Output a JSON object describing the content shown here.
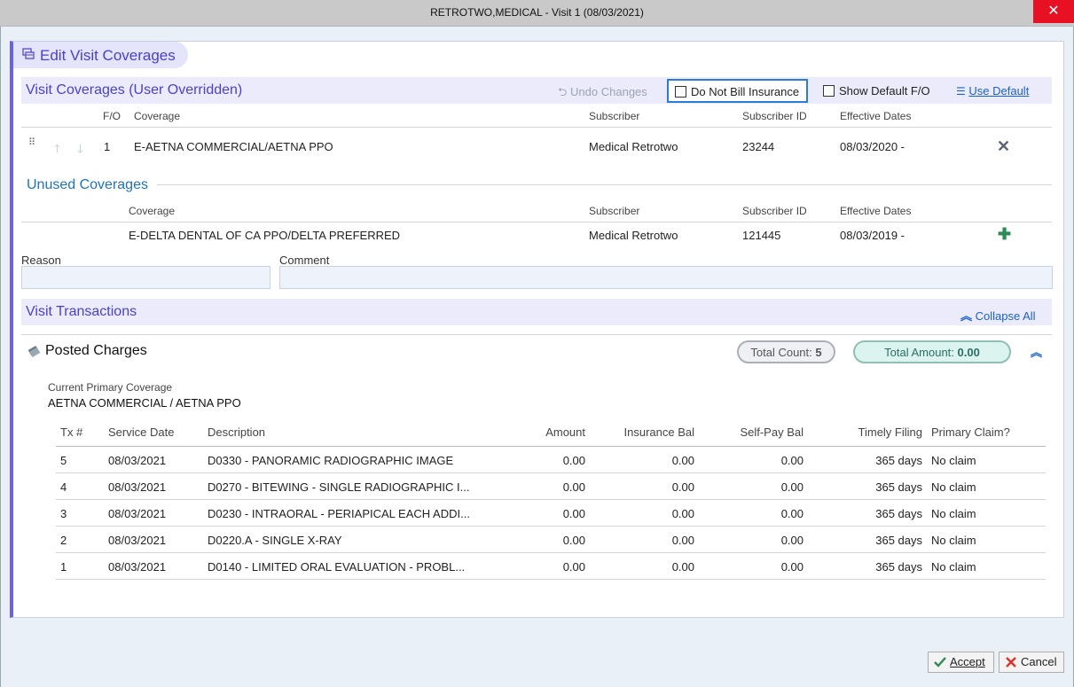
{
  "window": {
    "title": "RETROTWO,MEDICAL - Visit 1 (08/03/2021)",
    "close": "✕"
  },
  "panel": {
    "title": "Edit Visit Coverages"
  },
  "visit_coverages": {
    "section_title": "Visit Coverages (User Overridden)",
    "undo_label": "Undo Changes",
    "do_not_bill_label": "Do Not Bill Insurance",
    "show_default_label": "Show Default F/O",
    "use_default_label": "Use Default",
    "headers": {
      "fo": "F/O",
      "coverage": "Coverage",
      "subscriber": "Subscriber",
      "subscriber_id": "Subscriber ID",
      "effective": "Effective Dates"
    },
    "rows": [
      {
        "fo": "1",
        "coverage": "E-AETNA COMMERCIAL/AETNA PPO",
        "subscriber": "Medical Retrotwo",
        "subscriber_id": "23244",
        "effective": "08/03/2020 -"
      }
    ]
  },
  "unused_coverages": {
    "section_title": "Unused Coverages",
    "headers": {
      "coverage": "Coverage",
      "subscriber": "Subscriber",
      "subscriber_id": "Subscriber ID",
      "effective": "Effective Dates"
    },
    "rows": [
      {
        "coverage": "E-DELTA DENTAL OF CA PPO/DELTA PREFERRED",
        "subscriber": "Medical Retrotwo",
        "subscriber_id": "121445",
        "effective": "08/03/2019 -"
      }
    ]
  },
  "reason": {
    "label": "Reason",
    "value": ""
  },
  "comment": {
    "label": "Comment",
    "value": ""
  },
  "transactions": {
    "section_title": "Visit Transactions",
    "collapse_all_label": "Collapse All",
    "posted_charges_title": "Posted Charges",
    "total_count_label": "Total Count:",
    "total_count_value": "5",
    "total_amount_label": "Total Amount:",
    "total_amount_value": "0.00",
    "current_primary_label": "Current Primary Coverage",
    "current_primary_value": "AETNA COMMERCIAL / AETNA PPO",
    "headers": {
      "tx": "Tx #",
      "service_date": "Service Date",
      "description": "Description",
      "amount": "Amount",
      "ins_bal": "Insurance Bal",
      "self_pay": "Self-Pay Bal",
      "timely": "Timely Filing",
      "primary": "Primary Claim?"
    },
    "rows": [
      {
        "tx": "5",
        "service_date": "08/03/2021",
        "description": "D0330 - PANORAMIC RADIOGRAPHIC IMAGE",
        "amount": "0.00",
        "ins_bal": "0.00",
        "self_pay": "0.00",
        "timely": "365 days",
        "primary": "No claim"
      },
      {
        "tx": "4",
        "service_date": "08/03/2021",
        "description": "D0270 - BITEWING - SINGLE RADIOGRAPHIC I...",
        "amount": "0.00",
        "ins_bal": "0.00",
        "self_pay": "0.00",
        "timely": "365 days",
        "primary": "No claim"
      },
      {
        "tx": "3",
        "service_date": "08/03/2021",
        "description": "D0230 - INTRAORAL - PERIAPICAL EACH ADDI...",
        "amount": "0.00",
        "ins_bal": "0.00",
        "self_pay": "0.00",
        "timely": "365 days",
        "primary": "No claim"
      },
      {
        "tx": "2",
        "service_date": "08/03/2021",
        "description": "D0220.A - SINGLE X-RAY",
        "amount": "0.00",
        "ins_bal": "0.00",
        "self_pay": "0.00",
        "timely": "365 days",
        "primary": "No claim"
      },
      {
        "tx": "1",
        "service_date": "08/03/2021",
        "description": "D0140 - LIMITED ORAL EVALUATION - PROBL...",
        "amount": "0.00",
        "ins_bal": "0.00",
        "self_pay": "0.00",
        "timely": "365 days",
        "primary": "No claim"
      }
    ]
  },
  "footer": {
    "accept_label": "Accept",
    "cancel_label": "Cancel"
  },
  "colors": {
    "accent": "#6b63e6",
    "section_bg": "#ebebfb",
    "link": "#1a62c7",
    "success": "#2e8b57",
    "danger": "#d9342b"
  }
}
